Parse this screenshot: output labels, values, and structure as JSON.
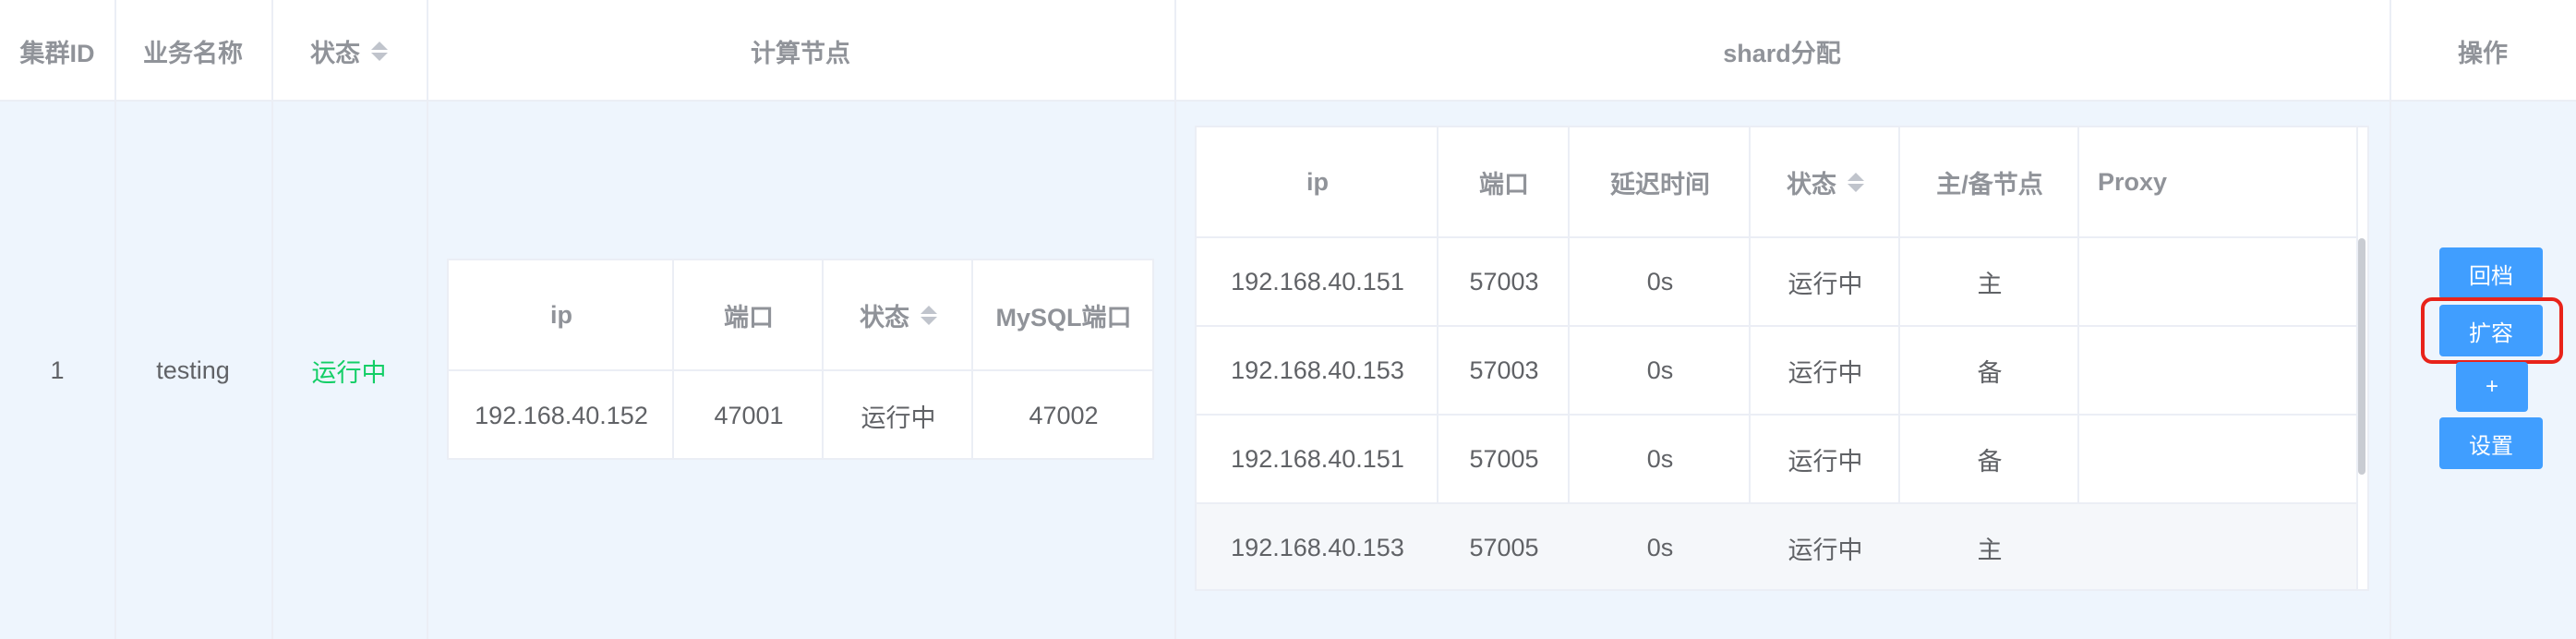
{
  "outer_table": {
    "headers": {
      "cluster_id": "集群ID",
      "business_name": "业务名称",
      "status": "状态",
      "compute_nodes": "计算节点",
      "shard_allocation": "shard分配",
      "operations": "操作"
    },
    "row": {
      "cluster_id": "1",
      "business_name": "testing",
      "status": "运行中"
    }
  },
  "compute_table": {
    "headers": {
      "ip": "ip",
      "port": "端口",
      "status": "状态",
      "mysql_port": "MySQL端口"
    },
    "rows": [
      {
        "ip": "192.168.40.152",
        "port": "47001",
        "status": "运行中",
        "mysql_port": "47002"
      }
    ]
  },
  "shard_table": {
    "headers": {
      "ip": "ip",
      "port": "端口",
      "delay": "延迟时间",
      "status": "状态",
      "role": "主/备节点",
      "proxy": "Proxy"
    },
    "rows": [
      {
        "ip": "192.168.40.151",
        "port": "57003",
        "delay": "0s",
        "status": "运行中",
        "role": "主",
        "proxy": ""
      },
      {
        "ip": "192.168.40.153",
        "port": "57003",
        "delay": "0s",
        "status": "运行中",
        "role": "备",
        "proxy": ""
      },
      {
        "ip": "192.168.40.151",
        "port": "57005",
        "delay": "0s",
        "status": "运行中",
        "role": "备",
        "proxy": ""
      },
      {
        "ip": "192.168.40.153",
        "port": "57005",
        "delay": "0s",
        "status": "运行中",
        "role": "主",
        "proxy": ""
      }
    ]
  },
  "actions": {
    "rollback": "回档",
    "expand": "扩容",
    "add": "+",
    "settings": "设置"
  },
  "colors": {
    "running": "#13ce66",
    "primary_role": "#1890ff",
    "button": "#409eff",
    "highlight": "#e8231a",
    "row_background": "#eef5fd"
  }
}
